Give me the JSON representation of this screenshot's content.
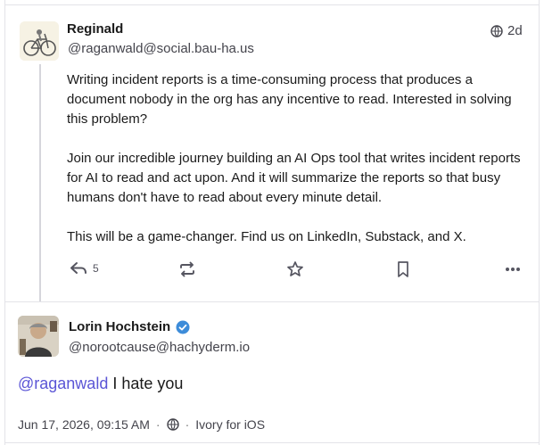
{
  "post": {
    "author_name": "Reginald",
    "author_handle": "@raganwald@social.bau-ha.us",
    "age": "2d",
    "paragraphs": [
      "Writing incident reports is a time-consuming process that produces a document nobody in the org has any incentive to read. Interested in solving this problem?",
      "Join our incredible journey building an AI Ops tool that writes incident reports for AI to read and act upon. And it will summarize the reports so that busy humans don't have to read about every minute detail.",
      "This will be a game-changer. Find us on LinkedIn, Substack, and X."
    ],
    "actions": {
      "reply_count": "5",
      "icons": [
        "reply-icon",
        "boost-icon",
        "favorite-icon",
        "bookmark-icon",
        "more-icon"
      ]
    }
  },
  "reply": {
    "author_name": "Lorin Hochstein",
    "author_handle": "@norootcause@hachyderm.io",
    "verified": true,
    "mention": "@raganwald",
    "text": " I hate you",
    "timestamp": "Jun 17, 2026, 09:15 AM",
    "visibility_icon": "globe-icon",
    "client": "Ivory for iOS"
  },
  "colors": {
    "mention": "#5b55d6",
    "verified": "#3d8cd9",
    "muted": "#44444c"
  }
}
